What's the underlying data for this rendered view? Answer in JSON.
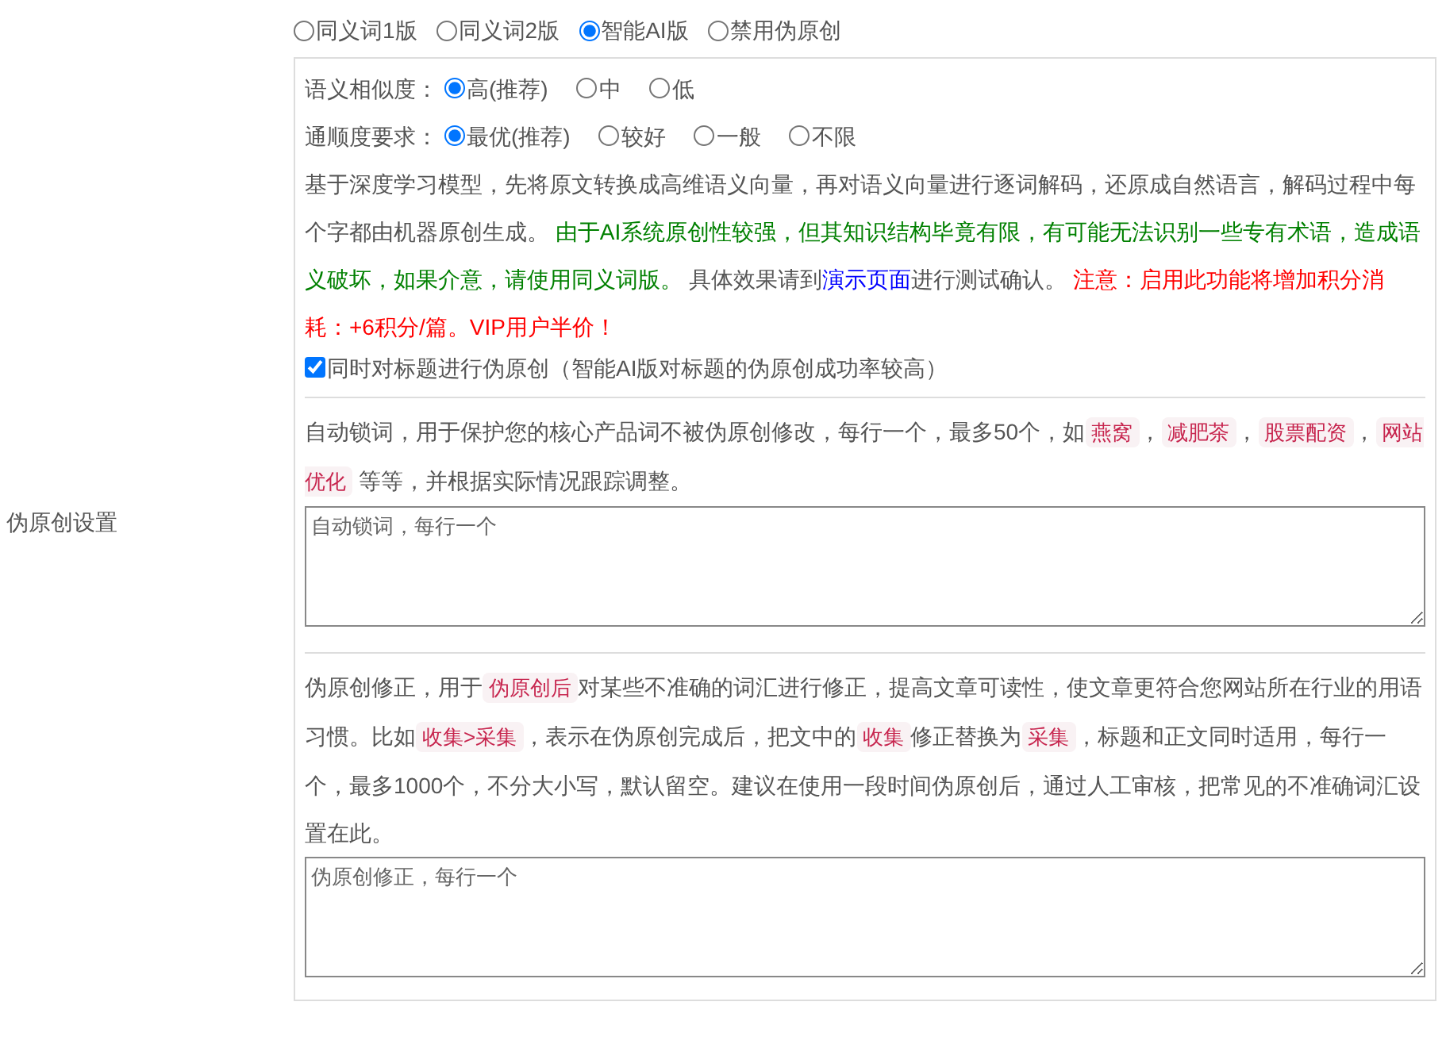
{
  "section_label": "伪原创设置",
  "modes": [
    {
      "label": "同义词1版",
      "selected": false
    },
    {
      "label": "同义词2版",
      "selected": false
    },
    {
      "label": "智能AI版",
      "selected": true
    },
    {
      "label": "禁用伪原创",
      "selected": false
    }
  ],
  "similarity": {
    "label": "语义相似度：",
    "options": [
      {
        "label": "高(推荐)",
        "selected": true
      },
      {
        "label": "中",
        "selected": false
      },
      {
        "label": "低",
        "selected": false
      }
    ]
  },
  "fluency": {
    "label": "通顺度要求：",
    "options": [
      {
        "label": "最优(推荐)",
        "selected": true
      },
      {
        "label": "较好",
        "selected": false
      },
      {
        "label": "一般",
        "selected": false
      },
      {
        "label": "不限",
        "selected": false
      }
    ]
  },
  "ai_description": [
    {
      "kind": "text",
      "text": "基于深度学习模型，先将原文转换成高维语义向量，再对语义向量进行逐词解码，还原成自然语言，解码过程中每个字都由机器原创生成。 "
    },
    {
      "kind": "success",
      "text": "由于AI系统原创性较强，但其知识结构毕竟有限，有可能无法识别一些专有术语，造成语义破坏，如果介意，请使用同义词版。"
    },
    {
      "kind": "text",
      "text": " 具体效果请到"
    },
    {
      "kind": "link",
      "text": "演示页面"
    },
    {
      "kind": "text",
      "text": "进行测试确认。 "
    },
    {
      "kind": "warning",
      "text": "注意：启用此功能将增加积分消耗：+6积分/篇。VIP用户半价！"
    }
  ],
  "title_option": {
    "label": "同时对标题进行伪原创（智能AI版对标题的伪原创成功率较高）",
    "checked": true
  },
  "lock_words": {
    "description": [
      {
        "kind": "text",
        "text": "自动锁词，用于保护您的核心产品词不被伪原创修改，每行一个，最多50个，如"
      },
      {
        "kind": "code",
        "text": "燕窝"
      },
      {
        "kind": "text",
        "text": "，"
      },
      {
        "kind": "code",
        "text": "减肥茶"
      },
      {
        "kind": "text",
        "text": "，"
      },
      {
        "kind": "code",
        "text": "股票配资"
      },
      {
        "kind": "text",
        "text": "，"
      },
      {
        "kind": "code",
        "text": "网站优化"
      },
      {
        "kind": "text",
        "text": " 等等，并根据实际情况跟踪调整。"
      }
    ],
    "placeholder": "自动锁词，每行一个"
  },
  "corrections": {
    "description": [
      {
        "kind": "text",
        "text": "伪原创修正，用于"
      },
      {
        "kind": "code",
        "text": "伪原创后"
      },
      {
        "kind": "text",
        "text": "对某些不准确的词汇进行修正，提高文章可读性，使文章更符合您网站所在行业的用语习惯。比如"
      },
      {
        "kind": "code",
        "text": "收集>采集"
      },
      {
        "kind": "text",
        "text": "，表示在伪原创完成后，把文中的"
      },
      {
        "kind": "code",
        "text": "收集"
      },
      {
        "kind": "text",
        "text": "修正替换为"
      },
      {
        "kind": "code",
        "text": "采集"
      },
      {
        "kind": "text",
        "text": "，标题和正文同时适用，每行一个，最多1000个，不分大小写，默认留空。建议在使用一段时间伪原创后，通过人工审核，把常见的不准确词汇设置在此。"
      }
    ],
    "placeholder": "伪原创修正，每行一个"
  }
}
